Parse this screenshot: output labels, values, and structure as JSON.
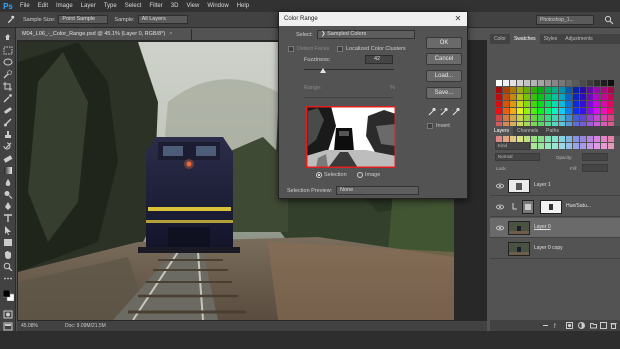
{
  "app": {
    "logo": "Ps"
  },
  "menu": [
    "File",
    "Edit",
    "Image",
    "Layer",
    "Type",
    "Select",
    "Filter",
    "3D",
    "View",
    "Window",
    "Help"
  ],
  "options_bar": {
    "sample_size_label": "Sample Size:",
    "sample_size_value": "Point Sample",
    "sample_label": "Sample:",
    "sample_value": "All Layers",
    "workspace": "Photoshop_1..."
  },
  "document": {
    "tab_title": "M04_L06_-_Color_Range.psd @ 45.1% (Layer 0, RGB/8*)",
    "close_glyph": "×",
    "zoom": "45.08%",
    "doc_size": "Doc: 9.09M/21.5M"
  },
  "dialog": {
    "title": "Color Range",
    "close_glyph": "✕",
    "select_label": "Select:",
    "select_value": "Sampled Colors",
    "detect_faces_label": "Detect Faces",
    "localized_label": "Localized Color Clusters",
    "fuzziness_label": "Fuzziness:",
    "fuzziness_value": "42",
    "fuzziness_fraction": 0.21,
    "range_label": "Range:",
    "range_unit": "%",
    "buttons": [
      "OK",
      "Cancel",
      "Load...",
      "Save..."
    ],
    "invert_label": "Invert",
    "radio_selection": "Selection",
    "radio_image": "Image",
    "preview_label": "Selection Preview:",
    "preview_value": "None",
    "frame_color": "#e21f1f"
  },
  "panels": {
    "color_tabs": [
      "Color",
      "Swatches",
      "Styles",
      "Adjustments"
    ],
    "layer_tabs": [
      "Layers",
      "Channels",
      "Paths"
    ],
    "kind_label": "Kind",
    "blend_mode": "Normal",
    "opacity_label": "Opacity:",
    "lock_label": "Lock:",
    "fill_label": "Fill:",
    "layers": [
      {
        "name": "Layer 1",
        "adj": "Hue/Satu..."
      },
      {
        "name": "Layer 0"
      },
      {
        "name": "Layer 0 copy"
      }
    ]
  }
}
